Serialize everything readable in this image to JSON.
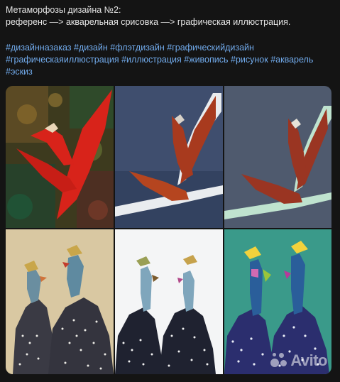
{
  "post": {
    "title_line": "Метаморфозы дизайна №2:",
    "subtitle_line": "референс —> акварельная срисовка —> графическая иллюстрация.",
    "hashtags": [
      "#дизайнназаказ",
      "#дизайн",
      "#флэтдизайн",
      "#графическийдизайн",
      "#графическаяиллюстрация",
      "#иллюстрация",
      "#живопись",
      "#рисунок",
      "#акварель",
      "#эскиз"
    ]
  },
  "gallery": {
    "images": [
      {
        "name": "bird-reference-painting",
        "row": 1,
        "col": 1
      },
      {
        "name": "bird-watercolor-copy",
        "row": 1,
        "col": 2
      },
      {
        "name": "bird-flat-illustration",
        "row": 1,
        "col": 3
      },
      {
        "name": "guineafowl-reference-painting",
        "row": 2,
        "col": 1
      },
      {
        "name": "guineafowl-watercolor-copy",
        "row": 2,
        "col": 2
      },
      {
        "name": "guineafowl-flat-illustration",
        "row": 2,
        "col": 3
      }
    ]
  },
  "watermark": {
    "text": "Avito",
    "icon": "avito-dots-logo"
  },
  "colors": {
    "hashtag": "#71aaeb",
    "text": "#e6e6e6",
    "background": "#141414"
  }
}
